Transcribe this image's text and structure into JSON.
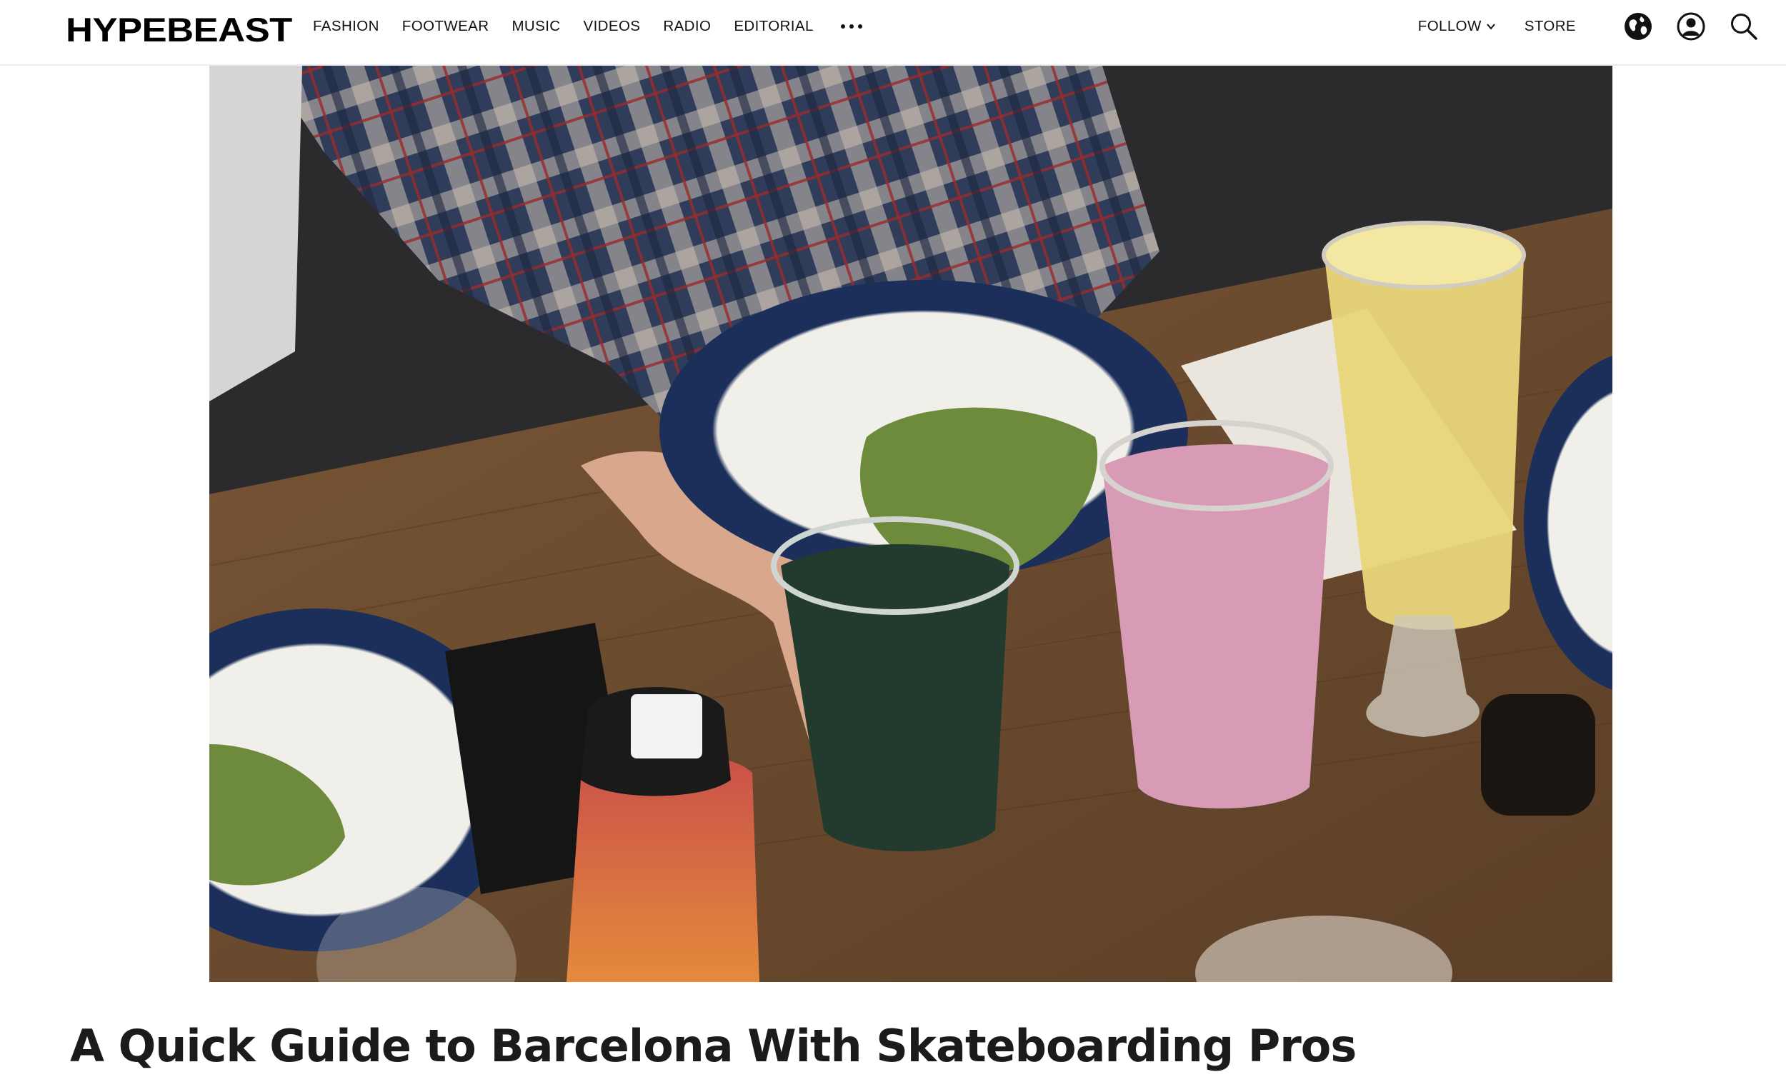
{
  "site": {
    "logo": "HYPEBEAST"
  },
  "nav": {
    "items": [
      {
        "label": "FASHION"
      },
      {
        "label": "FOOTWEAR"
      },
      {
        "label": "MUSIC"
      },
      {
        "label": "VIDEOS"
      },
      {
        "label": "RADIO"
      },
      {
        "label": "EDITORIAL"
      }
    ],
    "more_icon": "ellipsis-icon"
  },
  "header_right": {
    "follow_label": "FOLLOW",
    "follow_icon": "chevron-down-icon",
    "store_label": "STORE",
    "icons": [
      "globe-icon",
      "user-icon",
      "search-icon"
    ]
  },
  "article": {
    "hero_image": "photo of a person in a plaid shirt reaching for a glass of green juice on a wooden table with avocado toast, a pink smoothie and a yellow drink",
    "title": "A Quick Guide to Barcelona With Skateboarding Pros"
  }
}
